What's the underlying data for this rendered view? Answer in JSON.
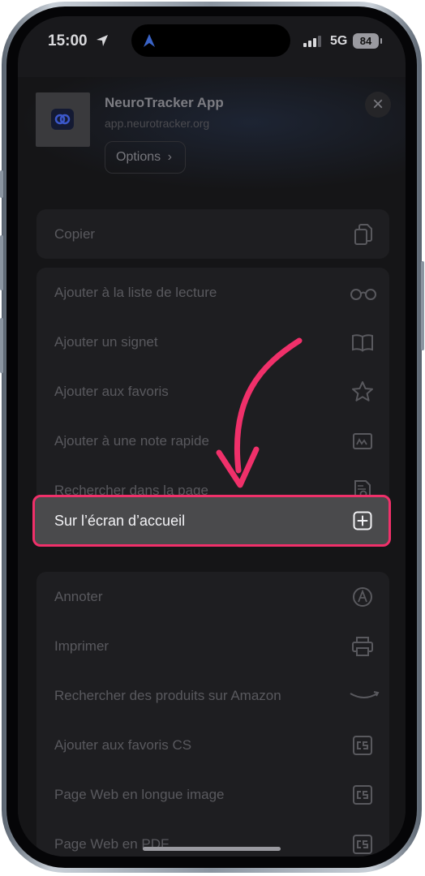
{
  "status": {
    "time": "15:00",
    "network": "5G",
    "battery": "84"
  },
  "sheet": {
    "app_title": "NeuroTracker App",
    "app_url": "app.neurotracker.org",
    "options_label": "Options",
    "options_chevron": "›",
    "close_glyph": "×"
  },
  "actions": {
    "copy": "Copier",
    "group1": [
      {
        "label": "Ajouter à la liste de lecture",
        "icon": "glasses-icon"
      },
      {
        "label": "Ajouter un signet",
        "icon": "book-icon"
      },
      {
        "label": "Ajouter aux favoris",
        "icon": "star-icon"
      },
      {
        "label": "Ajouter à une note rapide",
        "icon": "quick-note-icon"
      },
      {
        "label": "Rechercher dans la page",
        "icon": "search-page-icon"
      }
    ],
    "highlighted": {
      "label": "Sur l’écran d’accueil",
      "icon": "add-square-icon"
    },
    "group2": [
      {
        "label": "Annoter",
        "icon": "markup-icon"
      },
      {
        "label": "Imprimer",
        "icon": "printer-icon"
      },
      {
        "label": "Rechercher des produits sur Amazon",
        "icon": "amazon-icon"
      },
      {
        "label": "Ajouter aux favoris CS",
        "icon": "cs-icon"
      },
      {
        "label": "Page Web en longue image",
        "icon": "cs-icon"
      },
      {
        "label": "Page Web en PDF",
        "icon": "cs-icon"
      }
    ]
  },
  "colors": {
    "accent": "#f0306a",
    "sheet_bg": "#151517",
    "row_bg": "#1e1e21",
    "highlight_bg": "#4a4a4c"
  }
}
